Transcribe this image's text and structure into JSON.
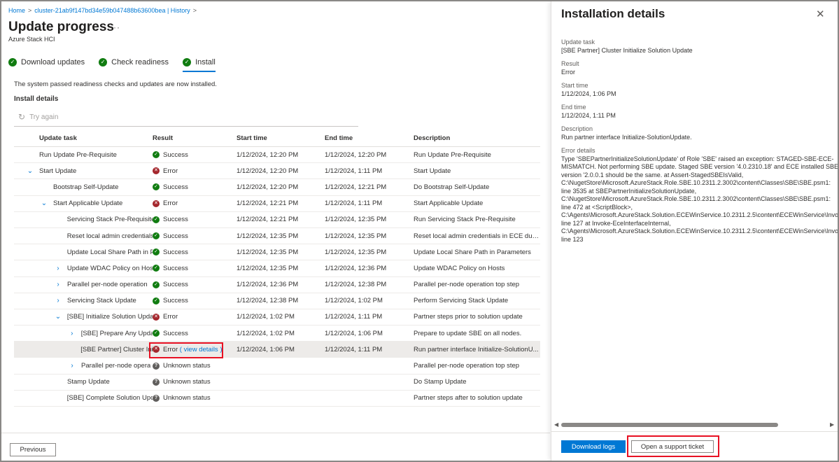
{
  "breadcrumb": [
    {
      "label": "Home"
    },
    {
      "label": "cluster-21ab9f147bd34e59b047488b63600bea | History"
    }
  ],
  "page": {
    "title": "Update progress",
    "more_glyph": "···",
    "subtitle": "Azure Stack HCI"
  },
  "steps": [
    {
      "label": "Download updates",
      "status": "completed"
    },
    {
      "label": "Check readiness",
      "status": "completed"
    },
    {
      "label": "Install",
      "status": "completed",
      "selected": true
    }
  ],
  "install": {
    "message": "The system passed readiness checks and updates are now installed.",
    "heading": "Install details",
    "try_again_label": "Try again"
  },
  "table": {
    "columns": {
      "task": "Update task",
      "result": "Result",
      "start": "Start time",
      "end": "End time",
      "description": "Description"
    },
    "rows": [
      {
        "task": "Run Update Pre-Requisite",
        "result": "Success",
        "status": "success",
        "start": "1/12/2024, 12:20 PM",
        "end": "1/12/2024, 12:20 PM",
        "description": "Run Update Pre-Requisite"
      },
      {
        "task": "Start Update",
        "result": "Error",
        "status": "error",
        "start": "1/12/2024, 12:20 PM",
        "end": "1/12/2024, 1:11 PM",
        "description": "Start Update"
      },
      {
        "task": "Bootstrap Self-Update",
        "result": "Success",
        "status": "success",
        "start": "1/12/2024, 12:20 PM",
        "end": "1/12/2024, 12:21 PM",
        "description": "Do Bootstrap Self-Update"
      },
      {
        "task": "Start Applicable Update",
        "result": "Error",
        "status": "error",
        "start": "1/12/2024, 12:21 PM",
        "end": "1/12/2024, 1:11 PM",
        "description": "Start Applicable Update"
      },
      {
        "task": "Servicing Stack Pre-Requisite",
        "result": "Success",
        "status": "success",
        "start": "1/12/2024, 12:21 PM",
        "end": "1/12/2024, 12:35 PM",
        "description": "Run Servicing Stack Pre-Requisite"
      },
      {
        "task": "Reset local admin credentials",
        "result": "Success",
        "status": "success",
        "start": "1/12/2024, 12:35 PM",
        "end": "1/12/2024, 12:35 PM",
        "description": "Reset local admin credentials in ECE durin..."
      },
      {
        "task": "Update Local Share Path in P",
        "result": "Success",
        "status": "success",
        "start": "1/12/2024, 12:35 PM",
        "end": "1/12/2024, 12:35 PM",
        "description": "Update Local Share Path in Parameters"
      },
      {
        "task": "Update WDAC Policy on Hos",
        "result": "Success",
        "status": "success",
        "start": "1/12/2024, 12:35 PM",
        "end": "1/12/2024, 12:36 PM",
        "description": "Update WDAC Policy on Hosts"
      },
      {
        "task": "Parallel per-node operation",
        "result": "Success",
        "status": "success",
        "start": "1/12/2024, 12:36 PM",
        "end": "1/12/2024, 12:38 PM",
        "description": "Parallel per-node operation top step"
      },
      {
        "task": "Servicing Stack Update",
        "result": "Success",
        "status": "success",
        "start": "1/12/2024, 12:38 PM",
        "end": "1/12/2024, 1:02 PM",
        "description": "Perform Servicing Stack Update"
      },
      {
        "task": "[SBE] Initialize Solution Upda",
        "result": "Error",
        "status": "error",
        "start": "1/12/2024, 1:02 PM",
        "end": "1/12/2024, 1:11 PM",
        "description": "Partner steps prior to solution update"
      },
      {
        "task": "[SBE] Prepare Any Upda",
        "result": "Success",
        "status": "success",
        "start": "1/12/2024, 1:02 PM",
        "end": "1/12/2024, 1:06 PM",
        "description": "Prepare to update SBE on all nodes."
      },
      {
        "task": "[SBE Partner] Cluster Initi",
        "result": "Error",
        "status": "error",
        "view_details": "( view details )",
        "start": "1/12/2024, 1:06 PM",
        "end": "1/12/2024, 1:11 PM",
        "description": "Run partner interface Initialize-SolutionU..."
      },
      {
        "task": "Parallel per-node opera",
        "result": "Unknown status",
        "status": "unknown",
        "start": "",
        "end": "",
        "description": "Parallel per-node operation top step"
      },
      {
        "task": "Stamp Update",
        "result": "Unknown status",
        "status": "unknown",
        "start": "",
        "end": "",
        "description": "Do Stamp Update"
      },
      {
        "task": "[SBE] Complete Solution Upc",
        "result": "Unknown status",
        "status": "unknown",
        "start": "",
        "end": "",
        "description": "Partner steps after to solution update"
      }
    ]
  },
  "footer": {
    "previous_label": "Previous"
  },
  "panel": {
    "title": "Installation details",
    "fields": {
      "update_task": {
        "label": "Update task",
        "value": "[SBE Partner] Cluster Initialize Solution Update"
      },
      "result": {
        "label": "Result",
        "value": "Error"
      },
      "start_time": {
        "label": "Start time",
        "value": "1/12/2024, 1:06 PM"
      },
      "end_time": {
        "label": "End time",
        "value": "1/12/2024, 1:11 PM"
      },
      "description": {
        "label": "Description",
        "value": "Run partner interface Initialize-SolutionUpdate."
      },
      "error_details": {
        "label": "Error details",
        "value": "Type 'SBEPartnerInitializeSolutionUpdate' of Role 'SBE' raised an exception: STAGED-SBE-ECE-\nMISMATCH. Not performing SBE update. Staged SBE version '4.0.2310.18' and ECE installed SBE\nversion '2.0.0.1 should be the same. at Assert-StagedSBEIsValid,\nC:\\NugetStore\\Microsoft.AzureStack.Role.SBE.10.2311.2.3002\\content\\Classes\\SBE\\SBE.psm1:\nline 3535 at SBEPartnerInitializeSolutionUpdate,\nC:\\NugetStore\\Microsoft.AzureStack.Role.SBE.10.2311.2.3002\\content\\Classes\\SBE\\SBE.psm1:\nline 472 at <ScriptBlock>,\nC:\\Agents\\Microsoft.AzureStack.Solution.ECEWinService.10.2311.2.5\\content\\ECEWinService\\Invoke\nline 127 at Invoke-EceInterfaceInternal,\nC:\\Agents\\Microsoft.AzureStack.Solution.ECEWinService.10.2311.2.5\\content\\ECEWinService\\Invoke\nline 123"
      }
    },
    "download_logs_label": "Download logs",
    "support_ticket_label": "Open a support ticket"
  },
  "colors": {
    "accent": "#0078d4",
    "success": "#107c10",
    "error": "#a4262c",
    "unknown": "#605e5c",
    "highlight": "#e81123"
  }
}
